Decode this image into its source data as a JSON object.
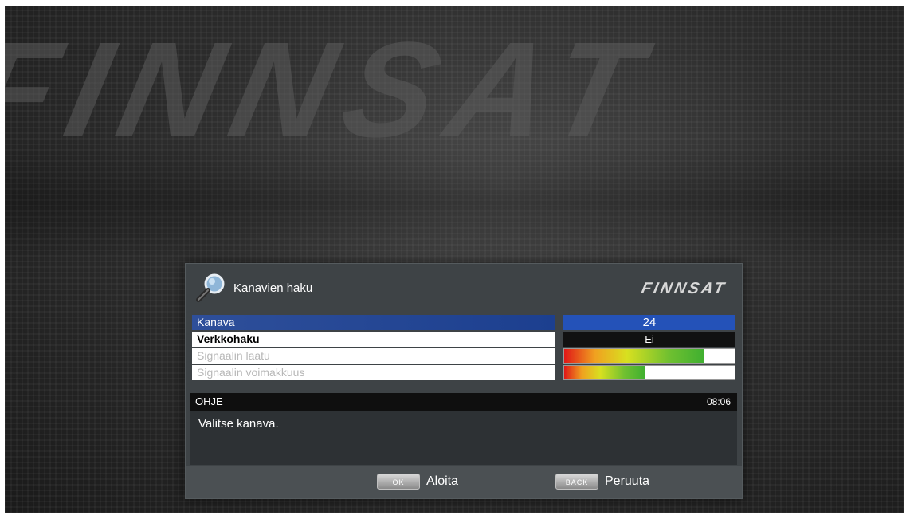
{
  "background": {
    "logo_text": "FINNSAT"
  },
  "dialog": {
    "title": "Kanavien haku",
    "brand": "FINNSAT",
    "icon": "search-icon",
    "rows": [
      {
        "label": "Kanava",
        "value": "24"
      },
      {
        "label": "Verkkohaku",
        "value": "Ei"
      },
      {
        "label": "Signaalin laatu",
        "level": 0.82
      },
      {
        "label": "Signaalin voimakkuus",
        "level": 0.47
      }
    ],
    "help": {
      "title": "OHJE",
      "clock": "08:06",
      "text": "Valitse kanava."
    },
    "footer": {
      "ok_key": "OK",
      "ok_label": "Aloita",
      "back_key": "BACK",
      "back_label": "Peruuta"
    }
  },
  "colors": {
    "selected_row": "#2452b8",
    "panel": "#3e4346",
    "bar_red": "#e01818",
    "bar_green": "#40b030"
  }
}
